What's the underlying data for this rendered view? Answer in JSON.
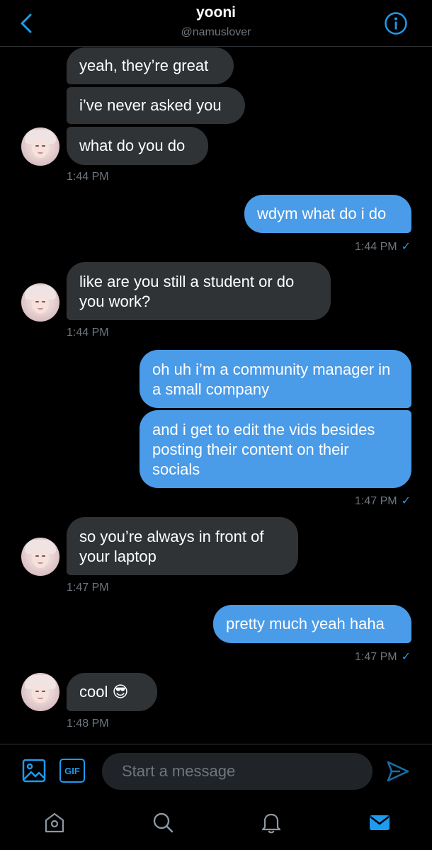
{
  "header": {
    "name": "yooni",
    "handle": "@namuslover"
  },
  "messages": [
    {
      "side": "in",
      "text": "yeah, they’re great"
    },
    {
      "side": "in",
      "text": "i’ve never asked you"
    },
    {
      "side": "in",
      "text": "what do you do",
      "time": "1:44 PM"
    },
    {
      "side": "out",
      "text": "wdym what do i do",
      "time": "1:44 PM"
    },
    {
      "side": "in",
      "text": "like are you still a student or do you work?",
      "time": "1:44 PM"
    },
    {
      "side": "out",
      "text": "oh uh i’m a community manager in a small company"
    },
    {
      "side": "out",
      "text": "and i get to edit the vids besides posting their content on their socials",
      "time": "1:47 PM"
    },
    {
      "side": "in",
      "text": "so you’re always in front of your laptop",
      "time": "1:47 PM"
    },
    {
      "side": "out",
      "text": "pretty much yeah haha",
      "time": "1:47 PM"
    },
    {
      "side": "in",
      "text": "cool 😎",
      "time": "1:48 PM"
    }
  ],
  "composer": {
    "placeholder": "Start a message",
    "gif_label": "GIF"
  },
  "icons": {
    "back": "chevron-left-icon",
    "info": "info-icon",
    "media": "image-icon",
    "send": "send-icon",
    "home": "home-icon",
    "search": "search-icon",
    "notifications": "bell-icon",
    "messages": "mail-icon"
  },
  "colors": {
    "accent": "#1d9bf0",
    "incoming_bubble": "#2f3336",
    "outgoing_bubble": "#4a9be8",
    "background": "#000000",
    "muted_text": "#6e767d"
  }
}
